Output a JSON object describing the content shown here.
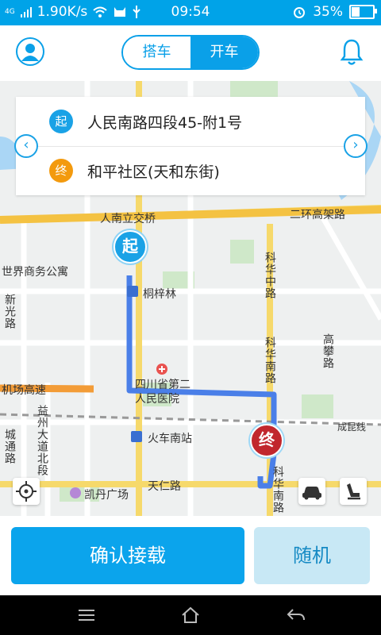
{
  "status_bar": {
    "network": "4G",
    "speed": "1.90K/s",
    "time": "09:54",
    "battery": "35%"
  },
  "header": {
    "tabs": [
      {
        "label": "搭车",
        "active": false
      },
      {
        "label": "开车",
        "active": true
      }
    ]
  },
  "route": {
    "start_badge": "起",
    "start_address": "人民南路四段45-附1号",
    "end_badge": "终",
    "end_address": "和平社区(天和东街)"
  },
  "map": {
    "labels": {
      "bridge": "人南立交桥",
      "ring_road": "二环高架路",
      "tzl": "桐梓林",
      "business": "世界商务公寓",
      "kehua_n": "科华中路",
      "kehua_s": "科华南路",
      "hospital1": "四川省第二",
      "hospital2": "人民医院",
      "airport": "机场高速",
      "gaopan": "高攀路",
      "yidao": "益州大道北段",
      "station": "火车南站",
      "chengkun": "成昆线",
      "tianren": "天仁路",
      "kaidan": "凯丹广场",
      "chengtong": "城通路",
      "xinguang": "新光路",
      "kehua_end": "科华南路"
    }
  },
  "actions": {
    "confirm_label": "确认接载",
    "random_label": "随机"
  },
  "colors": {
    "accent": "#0ba4ec",
    "start": "#1aa2e6",
    "end": "#f39a0e",
    "end_pin": "#c1272d",
    "route": "#4a7fe8"
  }
}
